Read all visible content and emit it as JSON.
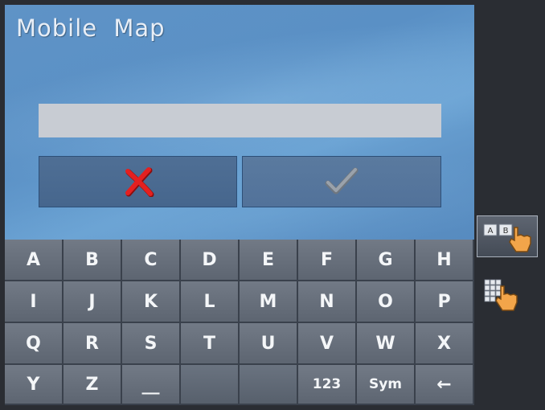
{
  "app": {
    "title": "Mobile Map"
  },
  "input": {
    "value": "",
    "placeholder": ""
  },
  "actions": {
    "cancel_icon": "cross-icon",
    "confirm_icon": "check-icon"
  },
  "keyboard": {
    "rows": [
      [
        "A",
        "B",
        "C",
        "D",
        "E",
        "F",
        "G",
        "H"
      ],
      [
        "I",
        "J",
        "K",
        "L",
        "M",
        "N",
        "O",
        "P"
      ],
      [
        "Q",
        "R",
        "S",
        "T",
        "U",
        "V",
        "W",
        "X"
      ],
      [
        "Y",
        "Z",
        "__",
        "",
        "",
        "123",
        "Sym",
        "←"
      ]
    ]
  },
  "side_panel": {
    "abc_mode": {
      "label_a": "A",
      "label_b": "B",
      "icon": "hand-pointer-icon"
    },
    "grid_mode": {
      "icon": "keypad-grid-icon"
    }
  },
  "colors": {
    "cancel": "#e01818",
    "confirm": "#8a949e",
    "background": "#5a90c5"
  }
}
